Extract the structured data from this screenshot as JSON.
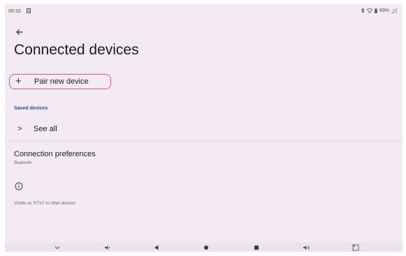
{
  "status_bar": {
    "time": "09:33",
    "battery_label": "89%",
    "icons": [
      "notification-icon",
      "bluetooth-icon",
      "wifi-icon",
      "battery-icon",
      "signal-icon"
    ]
  },
  "header": {
    "back_icon": "back-arrow-icon",
    "title": "Connected devices"
  },
  "pair_button": {
    "icon": "plus-icon",
    "plus_glyph": "+",
    "label": "Pair new device",
    "highlight_color": "#d85a63"
  },
  "saved_devices": {
    "header": "Saved devices",
    "see_all": {
      "icon": "chevron-right-icon",
      "chevron_glyph": ">",
      "label": "See all"
    }
  },
  "connection_preferences": {
    "title": "Connection preferences",
    "subtitle": "Bluetooth"
  },
  "info": {
    "icon": "info-icon",
    "text": "Visible as 'KT10' to other devices"
  },
  "nav_bar": {
    "buttons": [
      "chevron-down-icon",
      "volume-down-icon",
      "back-triangle-icon",
      "home-circle-icon",
      "recents-square-icon",
      "volume-up-icon",
      "screenshot-icon"
    ]
  },
  "colors": {
    "background": "#f3eaf3",
    "accent": "#3a4a8a",
    "text_primary": "#1c1b1f",
    "text_secondary": "#6a6470"
  }
}
